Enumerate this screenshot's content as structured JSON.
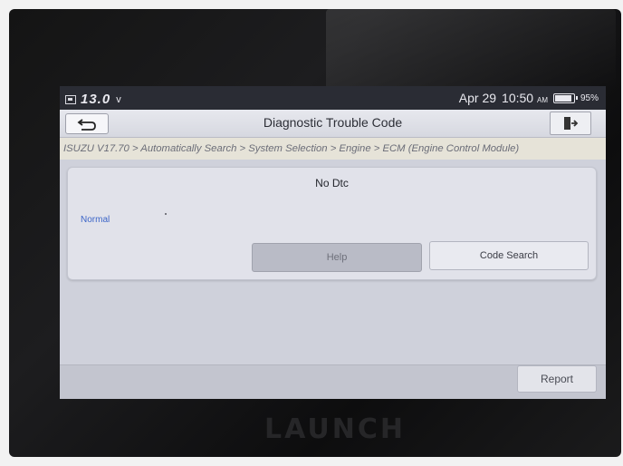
{
  "device": {
    "brand": "LAUNCH"
  },
  "statusbar": {
    "voltage": "13.0",
    "voltage_unit": "v",
    "date": "Apr 29",
    "time": "10:50",
    "ampm": "AM",
    "battery_percent": "95%",
    "battery_level": 0.95
  },
  "header": {
    "title": "Diagnostic Trouble Code",
    "back_icon": "back-arrow-icon",
    "exit_icon": "exit-door-icon"
  },
  "breadcrumb": "ISUZU V17.70 > Automatically Search > System Selection > Engine > ECM (Engine Control Module)",
  "result": {
    "title": "No Dtc",
    "status": "Normal",
    "help_label": "Help",
    "code_search_label": "Code Search"
  },
  "footer": {
    "report_label": "Report"
  },
  "colors": {
    "status_text": "#3d66c8",
    "statusbar_bg": "#2a2c34",
    "breadcrumb_bg": "#e6e3d8"
  }
}
